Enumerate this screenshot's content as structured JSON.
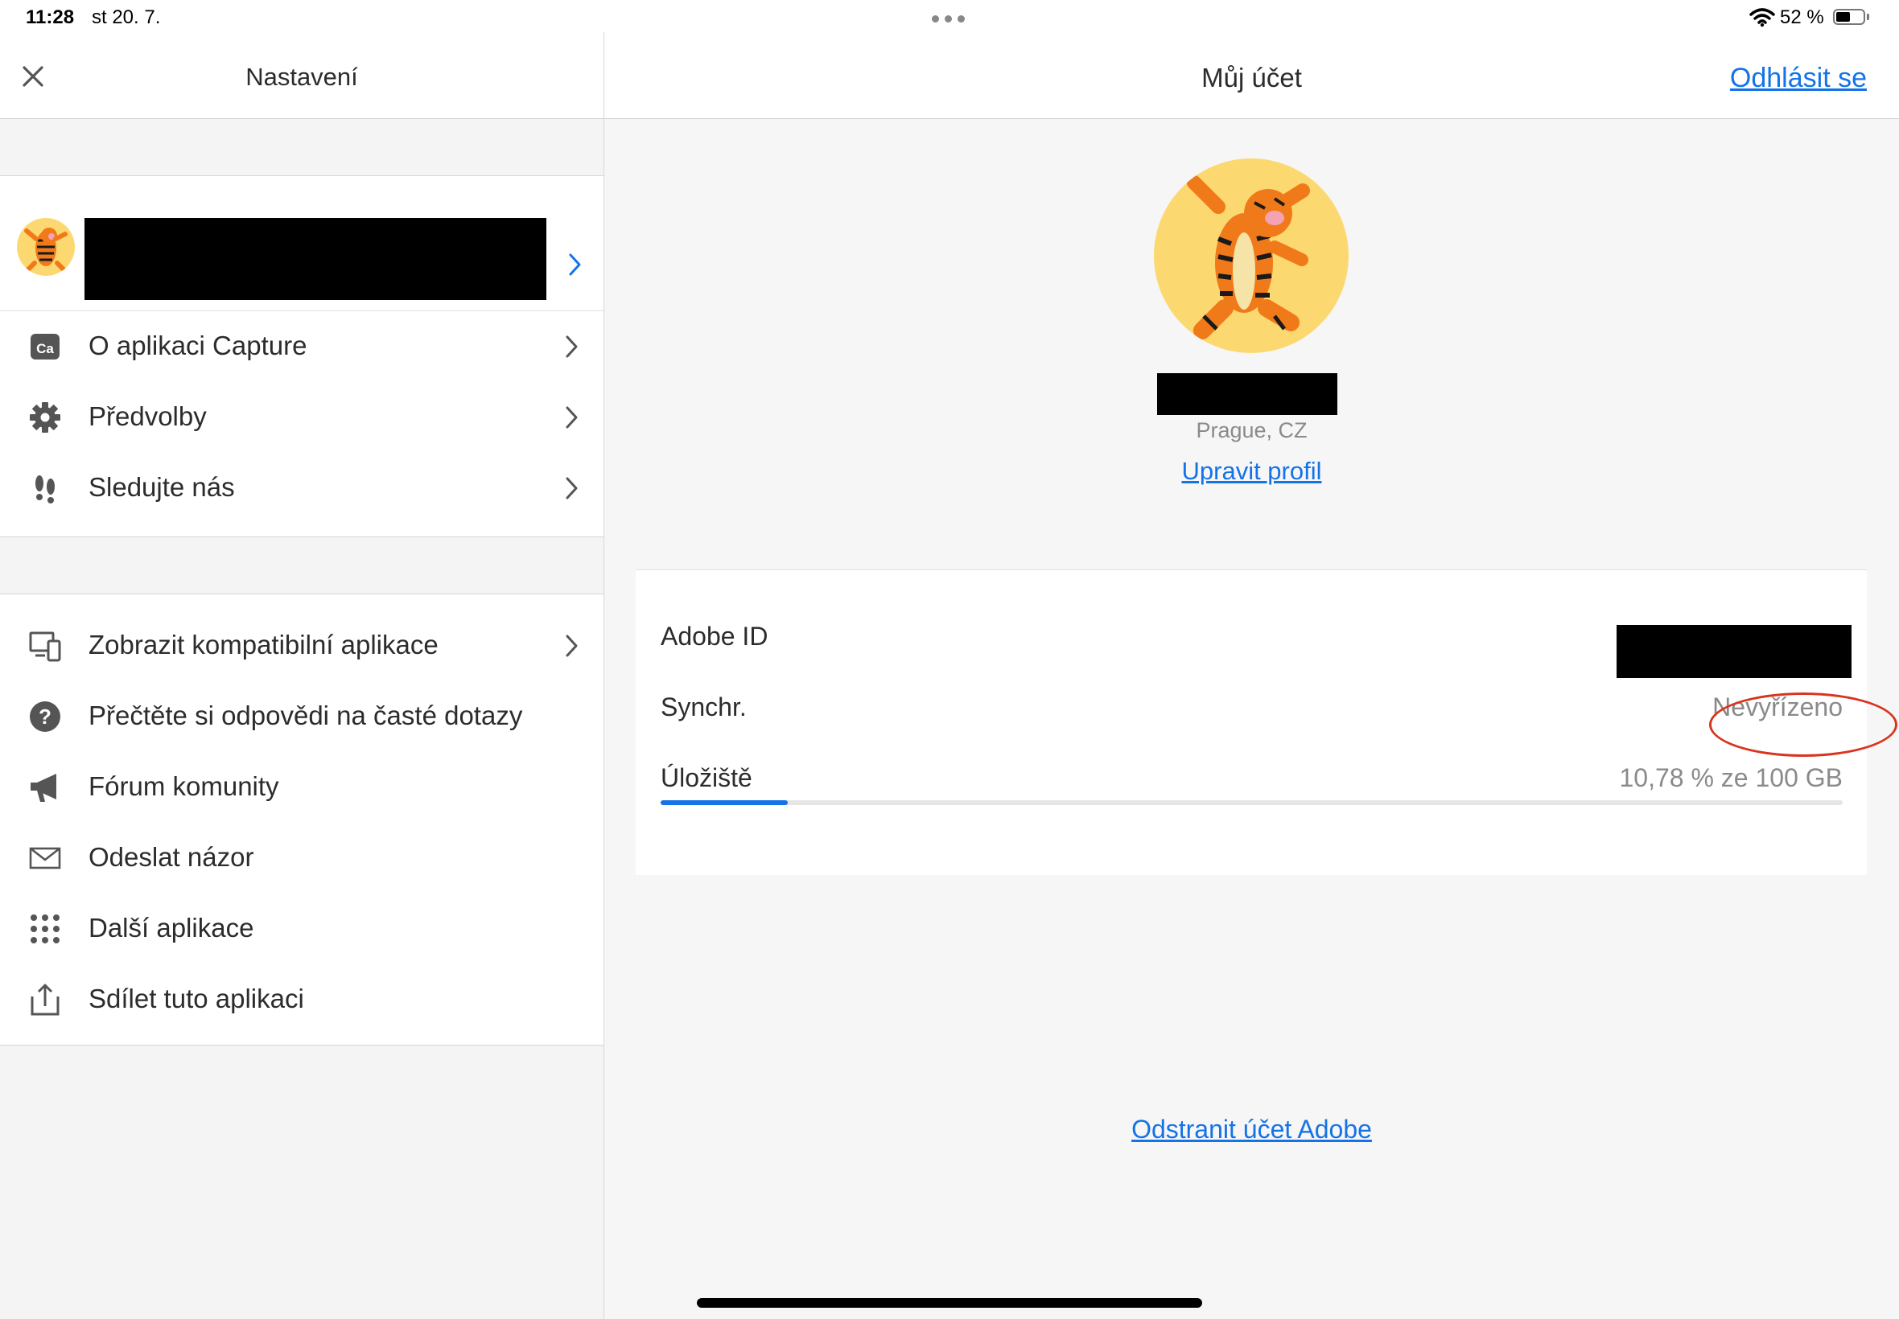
{
  "status_bar": {
    "time": "11:28",
    "date": "st 20. 7.",
    "battery_text": "52 %",
    "battery_level": 0.52,
    "icons": [
      "wifi-icon",
      "battery-icon",
      "multitask-dots-icon"
    ]
  },
  "settings_panel": {
    "title": "Nastavení",
    "group1": [
      {
        "label": "O aplikaci Capture",
        "icon": "capture-app-icon"
      },
      {
        "label": "Předvolby",
        "icon": "gear-icon"
      },
      {
        "label": "Sledujte nás",
        "icon": "footprints-icon"
      }
    ],
    "group2": [
      {
        "label": "Zobrazit kompatibilní aplikace",
        "icon": "devices-icon"
      },
      {
        "label": "Přečtěte si odpovědi na časté dotazy",
        "icon": "help-icon"
      },
      {
        "label": "Fórum komunity",
        "icon": "megaphone-icon"
      },
      {
        "label": "Odeslat názor",
        "icon": "mail-icon"
      },
      {
        "label": "Další aplikace",
        "icon": "grid-icon"
      },
      {
        "label": "Sdílet tuto aplikaci",
        "icon": "share-icon"
      }
    ]
  },
  "account_panel": {
    "title": "Můj účet",
    "logout_label": "Odhlásit se",
    "location": "Prague, CZ",
    "edit_profile_label": "Upravit profil",
    "adobe_id_label": "Adobe ID",
    "sync_label": "Synchr.",
    "sync_value": "Nevyřízeno",
    "storage_label": "Úložiště",
    "storage_value": "10,78 % ze 100 GB",
    "storage_fraction": 0.1078,
    "delete_account_label": "Odstranit účet Adobe",
    "colors": {
      "accent": "#1473e6",
      "annotation": "#d9341f",
      "redaction": "#000000"
    }
  }
}
